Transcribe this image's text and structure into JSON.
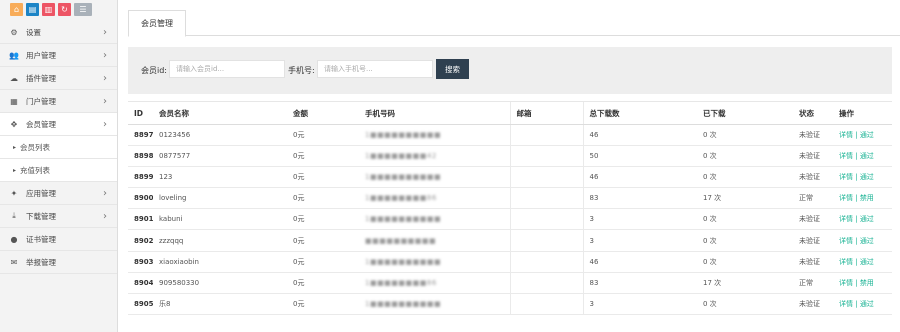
{
  "shortcuts": [
    {
      "icon": "home-icon",
      "glyph": "⌂",
      "color": "#f8ac59"
    },
    {
      "icon": "document-icon",
      "glyph": "▤",
      "color": "#1c84c6"
    },
    {
      "icon": "trash-icon",
      "glyph": "▥",
      "color": "#ed5565"
    },
    {
      "icon": "refresh-icon",
      "glyph": "↻",
      "color": "#ed5565"
    },
    {
      "icon": "list-icon",
      "glyph": "☰",
      "color": "#a9b1b9"
    }
  ],
  "sidebar": {
    "items": [
      {
        "label": "设置",
        "icon": "gears-icon",
        "glyph": "⚙",
        "arrow": "›"
      },
      {
        "label": "用户管理",
        "icon": "users-icon",
        "glyph": "👥",
        "arrow": "›"
      },
      {
        "label": "插件管理",
        "icon": "cloud-icon",
        "glyph": "☁",
        "arrow": "›"
      },
      {
        "label": "门户管理",
        "icon": "grid-icon",
        "glyph": "▦",
        "arrow": "›"
      },
      {
        "label": "会员管理",
        "icon": "move-icon",
        "glyph": "✥",
        "arrow": "›"
      },
      {
        "label": "会员列表"
      },
      {
        "label": "充值列表"
      },
      {
        "label": "应用管理",
        "icon": "android-icon",
        "glyph": "✦",
        "arrow": "›"
      },
      {
        "label": "下载管理",
        "icon": "download-icon",
        "glyph": "⤓",
        "arrow": "›"
      },
      {
        "label": "证书管理",
        "icon": "certificate-icon",
        "glyph": "●",
        "arrow": ""
      },
      {
        "label": "举报管理",
        "icon": "envelope-icon",
        "glyph": "✉",
        "arrow": ""
      }
    ]
  },
  "tab": {
    "label": "会员管理"
  },
  "search": {
    "member_label": "会员id:",
    "member_placeholder": "请输入会员id...",
    "phone_label": "手机号:",
    "phone_placeholder": "请输入手机号...",
    "button_label": "搜索"
  },
  "table": {
    "headers": [
      "ID",
      "会员名称",
      "金额",
      "手机号码",
      "邮箱",
      "总下载数",
      "已下载",
      "状态",
      "操作"
    ],
    "rows": [
      {
        "id": "8897",
        "name": "0123456",
        "amount": "0元",
        "phone": "1■■■■■■■■■■",
        "email": "",
        "total": "46",
        "downloaded": "0 次",
        "status": "未验证",
        "action1": "详情",
        "action2": "通过"
      },
      {
        "id": "8898",
        "name": "0877577",
        "amount": "0元",
        "phone": "1■■■■■■■■42",
        "email": "",
        "total": "50",
        "downloaded": "0 次",
        "status": "未验证",
        "action1": "详情",
        "action2": "通过"
      },
      {
        "id": "8899",
        "name": "123",
        "amount": "0元",
        "phone": "1■■■■■■■■■■",
        "email": "",
        "total": "46",
        "downloaded": "0 次",
        "status": "未验证",
        "action1": "详情",
        "action2": "通过"
      },
      {
        "id": "8900",
        "name": "loveling",
        "amount": "0元",
        "phone": "1■■■■■■■■86",
        "email": "",
        "total": "83",
        "downloaded": "17 次",
        "status": "正常",
        "action1": "详情",
        "action2": "禁用"
      },
      {
        "id": "8901",
        "name": "kabuni",
        "amount": "0元",
        "phone": "1■■■■■■■■■■",
        "email": "",
        "total": "3",
        "downloaded": "0 次",
        "status": "未验证",
        "action1": "详情",
        "action2": "通过"
      },
      {
        "id": "8902",
        "name": "zzzqqq",
        "amount": "0元",
        "phone": "■■■■■■■■■■",
        "email": "",
        "total": "3",
        "downloaded": "0 次",
        "status": "未验证",
        "action1": "详情",
        "action2": "通过"
      },
      {
        "id": "8903",
        "name": "xiaoxiaobin",
        "amount": "0元",
        "phone": "1■■■■■■■■■■",
        "email": "",
        "total": "46",
        "downloaded": "0 次",
        "status": "未验证",
        "action1": "详情",
        "action2": "通过"
      },
      {
        "id": "8904",
        "name": "909580330",
        "amount": "0元",
        "phone": "1■■■■■■■■86",
        "email": "",
        "total": "83",
        "downloaded": "17 次",
        "status": "正常",
        "action1": "详情",
        "action2": "禁用"
      },
      {
        "id": "8905",
        "name": "乐8",
        "amount": "0元",
        "phone": "1■■■■■■■■■■",
        "email": "",
        "total": "3",
        "downloaded": "0 次",
        "status": "未验证",
        "action1": "详情",
        "action2": "通过"
      }
    ]
  }
}
